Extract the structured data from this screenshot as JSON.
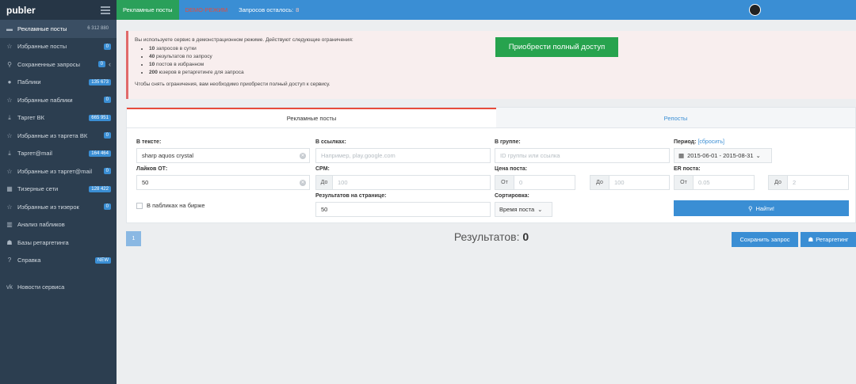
{
  "brand": "publer",
  "sidebar": {
    "items": [
      {
        "icon": "▬",
        "label": "Рекламные посты",
        "badge": "6 312 880",
        "badge_style": "plain",
        "active": true
      },
      {
        "icon": "☆",
        "label": "Избранные посты",
        "badge": "0"
      },
      {
        "icon": "⚲",
        "label": "Сохраненные запросы",
        "badge": "0",
        "chevron": "‹"
      },
      {
        "icon": "●",
        "label": "Паблики",
        "badge": "135 673"
      },
      {
        "icon": "☆",
        "label": "Избранные паблики",
        "badge": "0"
      },
      {
        "icon": "⤓",
        "label": "Таргет ВК",
        "badge": "665 951"
      },
      {
        "icon": "☆",
        "label": "Избранные из таргета ВК",
        "badge": "0"
      },
      {
        "icon": "⤓",
        "label": "Таргет@mail",
        "badge": "164 464"
      },
      {
        "icon": "☆",
        "label": "Избранные из таргет@mail",
        "badge": "0"
      },
      {
        "icon": "▦",
        "label": "Тизерные сети",
        "badge": "128 422"
      },
      {
        "icon": "☆",
        "label": "Избранные из тизерок",
        "badge": "0"
      },
      {
        "icon": "▥",
        "label": "Анализ пабликов",
        "badge": ""
      },
      {
        "icon": "☗",
        "label": "Базы ретаргетинга",
        "badge": ""
      },
      {
        "icon": "?",
        "label": "Справка",
        "badge": "NEW"
      },
      {
        "icon": "vk",
        "label": "Новости сервиса",
        "badge": ""
      }
    ]
  },
  "topbar": {
    "active_tab": "Рекламные посты",
    "demo_label": "DEMO-РЕЖИМ",
    "quota_label": "Запросов осталось:",
    "quota_value": "8"
  },
  "alert": {
    "intro": "Вы используете сервис в демонстрационном режиме. Действуют следующие ограничения:",
    "limits": [
      {
        "num": "10",
        "text": "запросов в сутки"
      },
      {
        "num": "40",
        "text": "результатов по запросу"
      },
      {
        "num": "10",
        "text": "постов в избранном"
      },
      {
        "num": "200",
        "text": "юзеров в ретаргетинге для запроса"
      }
    ],
    "outro": "Чтобы снять ограничения, вам необходимо приобрести полный доступ к сервису.",
    "buy_button": "Приобрести полный доступ"
  },
  "tabs": {
    "ads": "Рекламные посты",
    "reposts": "Репосты"
  },
  "form": {
    "text_label": "В тексте:",
    "text_value": "sharp aquos crystal",
    "likes_label": "Лайков ОТ:",
    "likes_value": "50",
    "paid_checkbox": "В пабликах на бирже",
    "links_label": "В ссылках:",
    "links_placeholder": "Например, play.google.com",
    "cpm_label": "CPM:",
    "cpm_from_addon": "До",
    "cpm_from_placeholder": "100",
    "per_page_label": "Результатов на странице:",
    "per_page_value": "50",
    "group_label": "В группе:",
    "group_placeholder": "ID группы или ссылка",
    "price_label": "Цена поста:",
    "price_from_addon": "От",
    "price_from_placeholder": "0",
    "price_to_addon": "До",
    "price_to_placeholder": "100",
    "sort_label": "Сортировка:",
    "sort_value": "Время поста",
    "period_label": "Период:",
    "period_reset": "[сбросить]",
    "period_value": "2015-06-01 - 2015-08-31",
    "er_label": "ER поста:",
    "er_from_addon": "От",
    "er_from_placeholder": "0.05",
    "er_to_addon": "До",
    "er_to_placeholder": "2",
    "find_button": "Найти!"
  },
  "results": {
    "page": "1",
    "label": "Результатов:",
    "count": "0",
    "save_button": "Сохранить запрос",
    "retarget_button": "Ретаргетинг"
  }
}
